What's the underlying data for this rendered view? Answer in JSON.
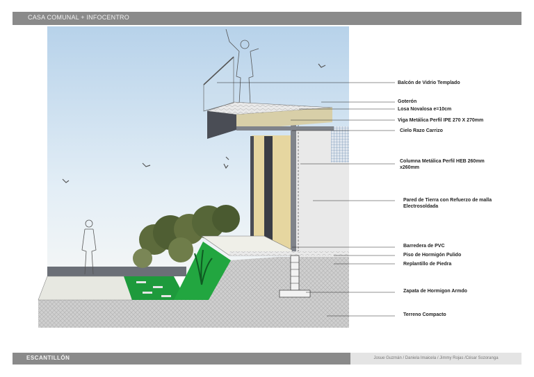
{
  "header": {
    "title": "CASA COMUNAL + INFOCENTRO"
  },
  "footer": {
    "section": "ESCANTILLÓN",
    "authors": "Josue Guzmán / Daniela Imaicela / Jimmy Rojas /César Sozoranga"
  },
  "labels": [
    {
      "id": "balcon",
      "lines": [
        "Balcón de Vidrio Templado"
      ]
    },
    {
      "id": "goteron",
      "lines": [
        "Goterón"
      ]
    },
    {
      "id": "losa",
      "lines": [
        "Losa Novalosa e=10cm"
      ]
    },
    {
      "id": "viga",
      "lines": [
        "Viga Metálica Perfil IPE 270 X 270mm"
      ]
    },
    {
      "id": "cielo",
      "lines": [
        "Cielo Razo Carrizo"
      ]
    },
    {
      "id": "columna",
      "lines": [
        "Columna Metálica Perfil HEB 260mm",
        "x260mm"
      ]
    },
    {
      "id": "pared",
      "lines": [
        "Pared de Tierra con Refuerzo de malla",
        "Electrosoldada"
      ]
    },
    {
      "id": "barredera",
      "lines": [
        "Barredera de PVC"
      ]
    },
    {
      "id": "piso",
      "lines": [
        "Piso de Hormigón Pulido"
      ]
    },
    {
      "id": "replantillo",
      "lines": [
        "Replantillo de Piedra"
      ]
    },
    {
      "id": "zapata",
      "lines": [
        "Zapata de Hormigon Armdo"
      ]
    },
    {
      "id": "terreno",
      "lines": [
        "Terreno Compacto"
      ]
    }
  ],
  "colors": {
    "bar": "#8a8a8a",
    "sky_top": "#b9d3ea",
    "grass": "#1e9a3c",
    "wall_wood": "#e6d6a0",
    "steel": "#4a4d55"
  }
}
